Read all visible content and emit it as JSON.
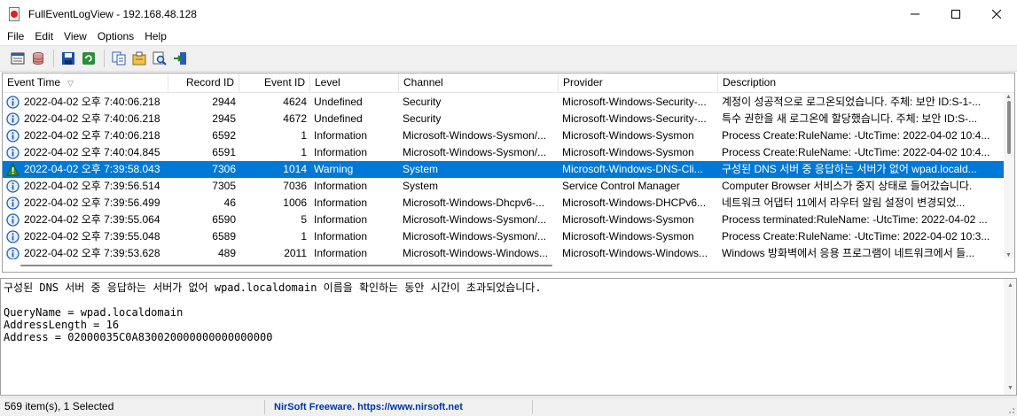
{
  "window": {
    "title": "FullEventLogView - 192.168.48.128"
  },
  "menu": [
    "File",
    "Edit",
    "View",
    "Options",
    "Help"
  ],
  "toolbar": {
    "icons": [
      "properties-icon",
      "database-icon",
      "save-icon",
      "refresh-icon",
      "copy-icon",
      "advanced-options-icon",
      "find-icon",
      "exit-icon"
    ]
  },
  "columns": {
    "event_time": "Event Time",
    "record_id": "Record ID",
    "event_id": "Event ID",
    "level": "Level",
    "channel": "Channel",
    "provider": "Provider",
    "description": "Description"
  },
  "rows": [
    {
      "time": "2022-04-02 오후 7:40:06.218",
      "record": "2944",
      "event": "4624",
      "level": "Undefined",
      "channel": "Security",
      "provider": "Microsoft-Windows-Security-...",
      "description": "계정이 성공적으로 로그온되었습니다. 주체: 보안 ID:S-1-...",
      "icon": "info-icon"
    },
    {
      "time": "2022-04-02 오후 7:40:06.218",
      "record": "2945",
      "event": "4672",
      "level": "Undefined",
      "channel": "Security",
      "provider": "Microsoft-Windows-Security-...",
      "description": "특수 권한을 새 로그온에 할당했습니다. 주체: 보안 ID:S-...",
      "icon": "info-icon"
    },
    {
      "time": "2022-04-02 오후 7:40:06.218",
      "record": "6592",
      "event": "1",
      "level": "Information",
      "channel": "Microsoft-Windows-Sysmon/...",
      "provider": "Microsoft-Windows-Sysmon",
      "description": "Process Create:RuleName: -UtcTime: 2022-04-02 10:4...",
      "icon": "info-icon"
    },
    {
      "time": "2022-04-02 오후 7:40:04.845",
      "record": "6591",
      "event": "1",
      "level": "Information",
      "channel": "Microsoft-Windows-Sysmon/...",
      "provider": "Microsoft-Windows-Sysmon",
      "description": "Process Create:RuleName: -UtcTime: 2022-04-02 10:4...",
      "icon": "info-icon"
    },
    {
      "time": "2022-04-02 오후 7:39:58.043",
      "record": "7306",
      "event": "1014",
      "level": "Warning",
      "channel": "System",
      "provider": "Microsoft-Windows-DNS-Cli...",
      "description": "구성된 DNS 서버 중 응답하는 서버가 없어 wpad.locald...",
      "icon": "warning-icon",
      "selected": true
    },
    {
      "time": "2022-04-02 오후 7:39:56.514",
      "record": "7305",
      "event": "7036",
      "level": "Information",
      "channel": "System",
      "provider": "Service Control Manager",
      "description": "Computer Browser 서비스가 중지 상태로 들어갔습니다.",
      "icon": "info-icon"
    },
    {
      "time": "2022-04-02 오후 7:39:56.499",
      "record": "46",
      "event": "1006",
      "level": "Information",
      "channel": "Microsoft-Windows-Dhcpv6-...",
      "provider": "Microsoft-Windows-DHCPv6...",
      "description": "네트워크 어댑터 11에서 라우터 알림 설정이 변경되었...",
      "icon": "info-icon"
    },
    {
      "time": "2022-04-02 오후 7:39:55.064",
      "record": "6590",
      "event": "5",
      "level": "Information",
      "channel": "Microsoft-Windows-Sysmon/...",
      "provider": "Microsoft-Windows-Sysmon",
      "description": "Process terminated:RuleName: -UtcTime: 2022-04-02 ...",
      "icon": "info-icon"
    },
    {
      "time": "2022-04-02 오후 7:39:55.048",
      "record": "6589",
      "event": "1",
      "level": "Information",
      "channel": "Microsoft-Windows-Sysmon/...",
      "provider": "Microsoft-Windows-Sysmon",
      "description": "Process Create:RuleName: -UtcTime: 2022-04-02 10:3...",
      "icon": "info-icon"
    },
    {
      "time": "2022-04-02 오후 7:39:53.628",
      "record": "489",
      "event": "2011",
      "level": "Information",
      "channel": "Microsoft-Windows-Windows...",
      "provider": "Microsoft-Windows-Windows...",
      "description": "Windows 방화벽에서 응용 프로그램이 네트워크에서 들...",
      "icon": "info-icon"
    }
  ],
  "detail": {
    "text": "구성된 DNS 서버 중 응답하는 서버가 없어 wpad.localdomain 이름을 확인하는 동안 시간이 초과되었습니다.\n\nQueryName = wpad.localdomain\nAddressLength = 16\nAddress = 02000035C0A830020000000000000000"
  },
  "status": {
    "count": "569 item(s), 1 Selected",
    "link": "NirSoft Freeware. https://www.nirsoft.net"
  },
  "colors": {
    "selection": "#0078d7",
    "info": "#1f5fb4",
    "warning": "#3a8a2e",
    "link": "#0033aa"
  }
}
